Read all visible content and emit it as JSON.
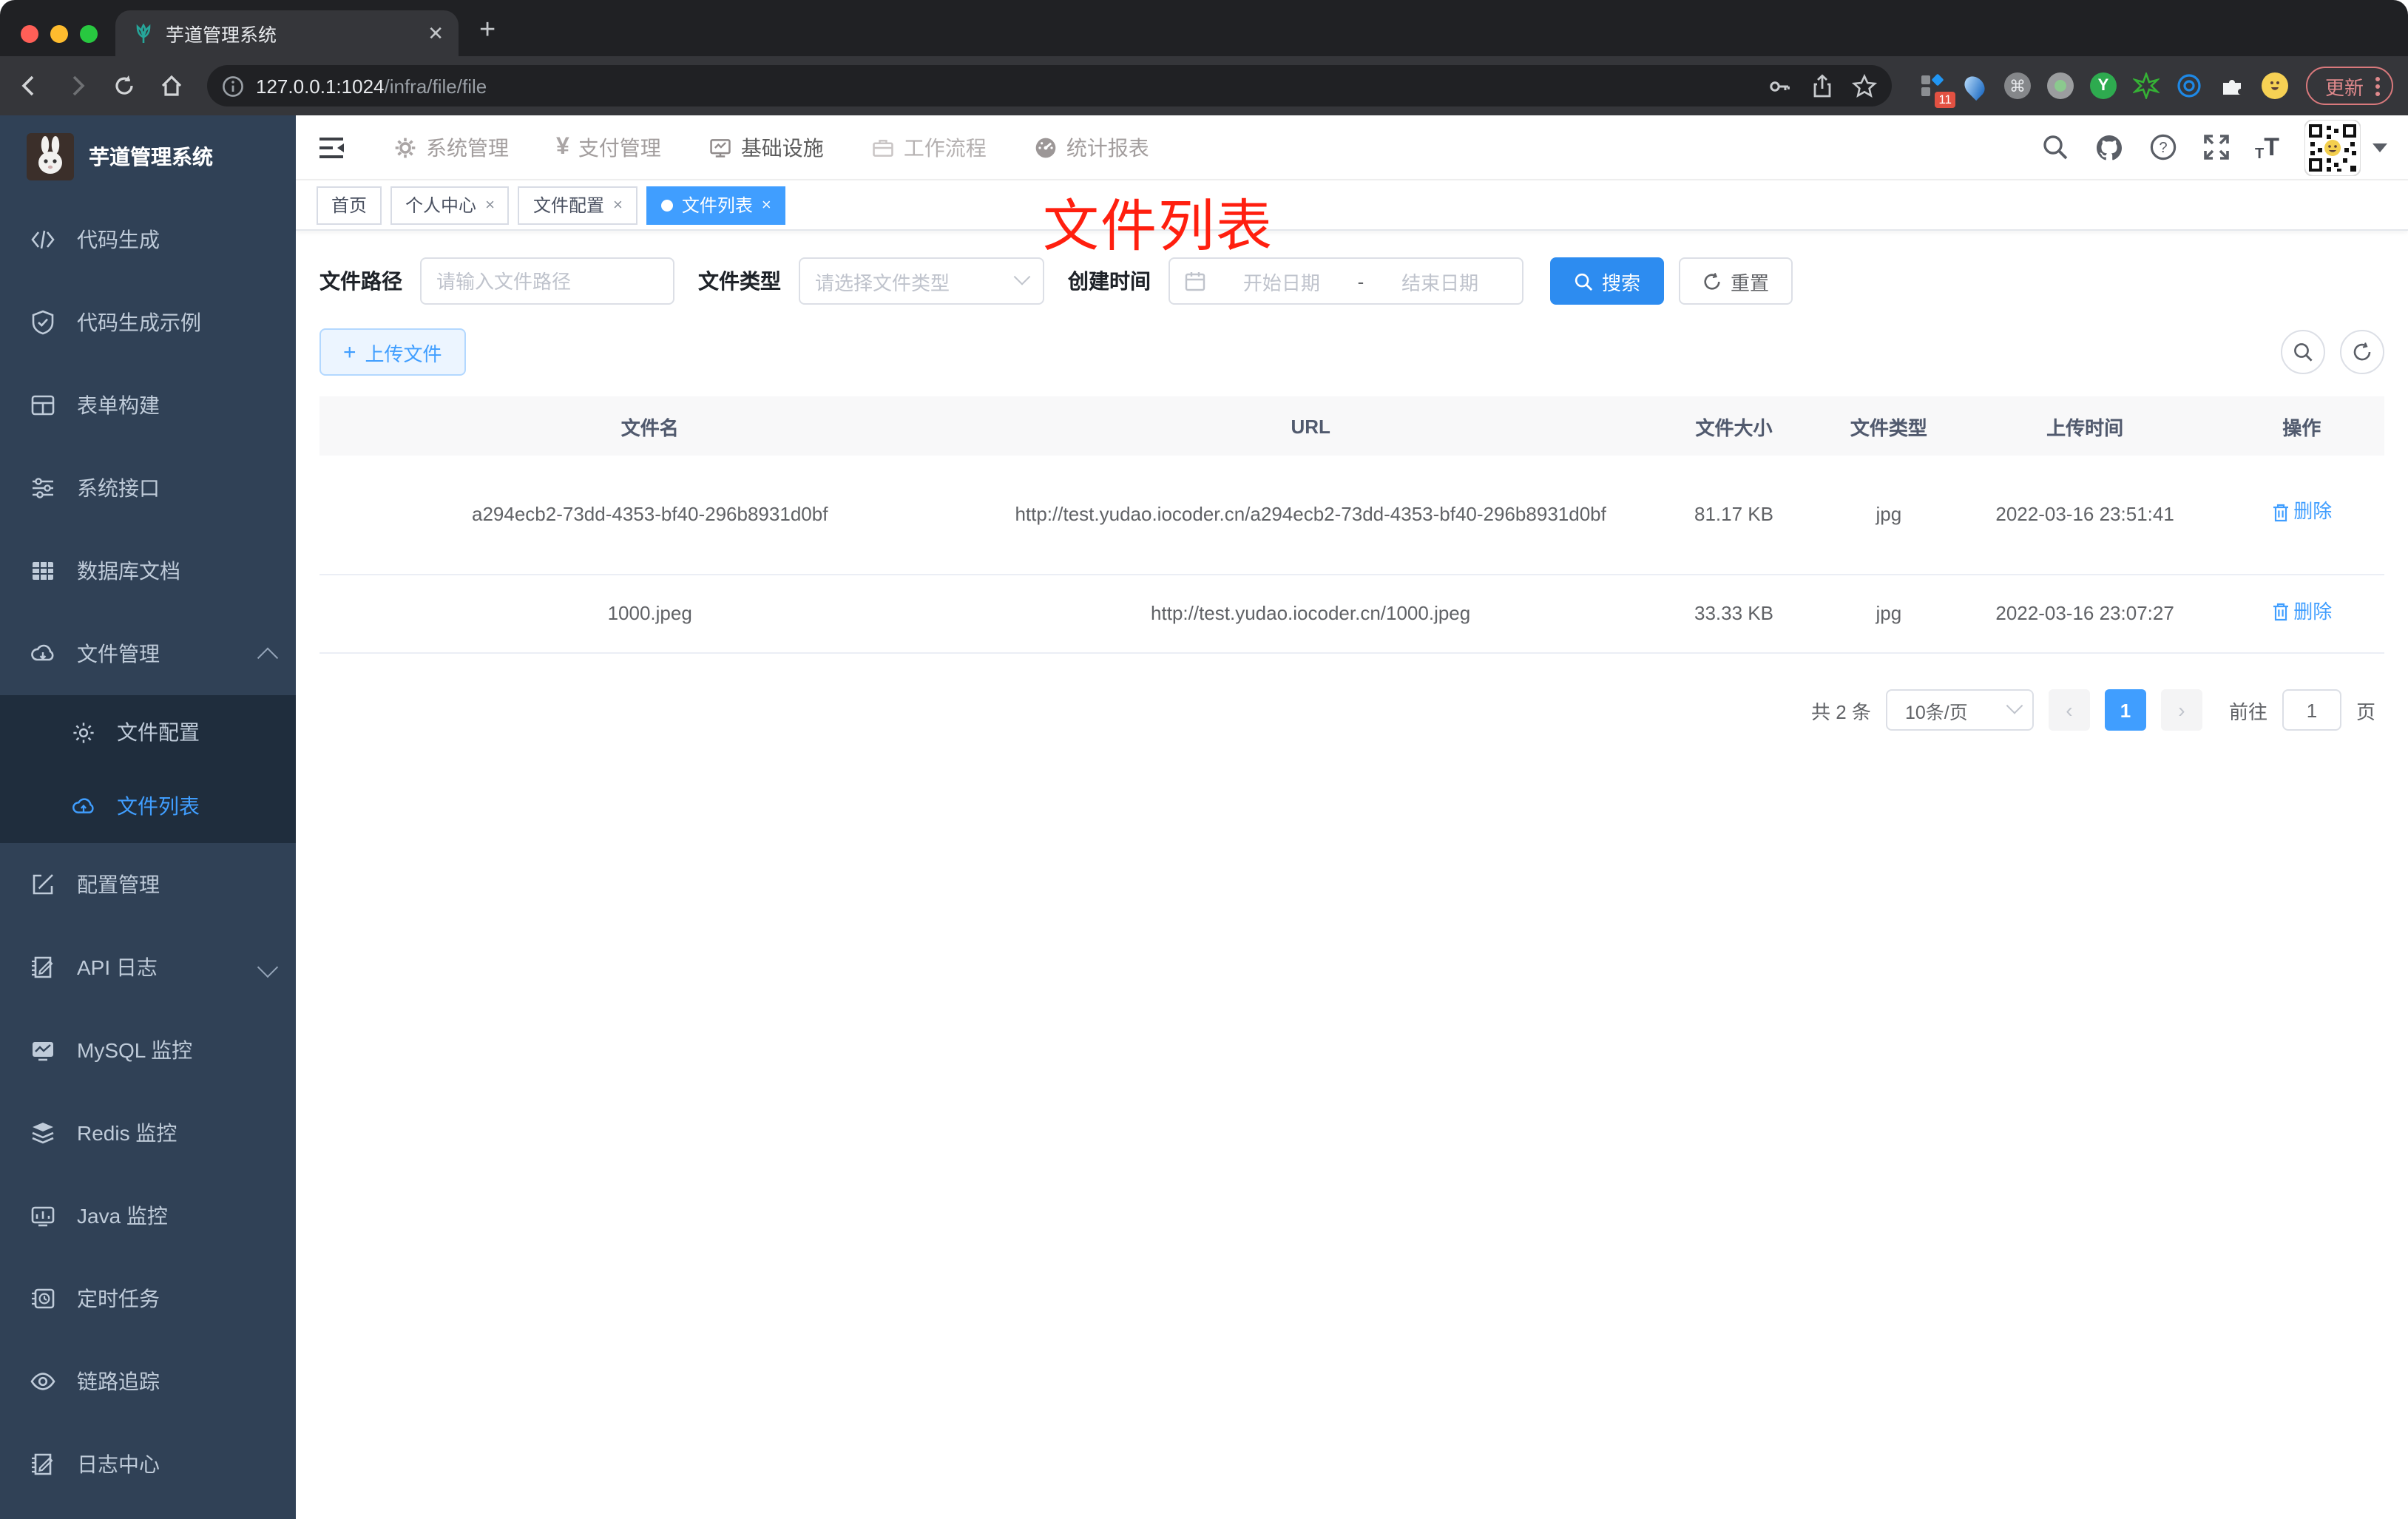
{
  "colors": {
    "accent": "#409eff",
    "sidebar_bg": "#304156",
    "submenu_bg": "#1f2d3d",
    "annotation": "#ff1f0f",
    "update_red": "#e0898c"
  },
  "browser": {
    "tab_title": "芋道管理系统",
    "url_host": "127.0.0.1:1024",
    "url_path": "/infra/file/file",
    "extension_badge": "11",
    "ext_command_glyph": "⌘",
    "ext_y_label": "Y",
    "update_label": "更新"
  },
  "sidebar": {
    "title": "芋道管理系统",
    "items": [
      {
        "label": "代码生成"
      },
      {
        "label": "代码生成示例"
      },
      {
        "label": "表单构建"
      },
      {
        "label": "系统接口"
      },
      {
        "label": "数据库文档"
      },
      {
        "label": "文件管理"
      },
      {
        "label": "文件配置"
      },
      {
        "label": "文件列表"
      },
      {
        "label": "配置管理"
      },
      {
        "label": "API 日志"
      },
      {
        "label": "MySQL 监控"
      },
      {
        "label": "Redis 监控"
      },
      {
        "label": "Java 监控"
      },
      {
        "label": "定时任务"
      },
      {
        "label": "链路追踪"
      },
      {
        "label": "日志中心"
      }
    ]
  },
  "header": {
    "menus": [
      {
        "label": "系统管理"
      },
      {
        "label": "支付管理"
      },
      {
        "label": "基础设施"
      },
      {
        "label": "工作流程"
      },
      {
        "label": "统计报表"
      }
    ],
    "yen_glyph": "¥",
    "fontsize_small": "T",
    "fontsize_big": "T"
  },
  "tags": [
    {
      "label": "首页"
    },
    {
      "label": "个人中心",
      "close": "×"
    },
    {
      "label": "文件配置",
      "close": "×"
    },
    {
      "label": "文件列表",
      "close": "×"
    }
  ],
  "annotation": "文件列表",
  "filters": {
    "path_label": "文件路径",
    "path_placeholder": "请输入文件路径",
    "type_label": "文件类型",
    "type_placeholder": "请选择文件类型",
    "date_label": "创建时间",
    "date_start": "开始日期",
    "date_separator": "-",
    "date_end": "结束日期",
    "search_label": "搜索",
    "reset_label": "重置"
  },
  "toolbar": {
    "upload_label": "上传文件"
  },
  "table": {
    "columns": [
      "文件名",
      "URL",
      "文件大小",
      "文件类型",
      "上传时间",
      "操作"
    ],
    "rows": [
      {
        "name": "a294ecb2-73dd-4353-bf40-296b8931d0bf",
        "url": "http://test.yudao.iocoder.cn/a294ecb2-73dd-4353-bf40-296b8931d0bf",
        "size": "81.17 KB",
        "type": "jpg",
        "time": "2022-03-16 23:51:41",
        "action": "删除"
      },
      {
        "name": "1000.jpeg",
        "url": "http://test.yudao.iocoder.cn/1000.jpeg",
        "size": "33.33 KB",
        "type": "jpg",
        "time": "2022-03-16 23:07:27",
        "action": "删除"
      }
    ]
  },
  "pagination": {
    "total": "共 2 条",
    "page_size": "10条/页",
    "prev": "‹",
    "page": "1",
    "next": "›",
    "goto_prefix": "前往",
    "goto_value": "1",
    "goto_suffix": "页"
  }
}
